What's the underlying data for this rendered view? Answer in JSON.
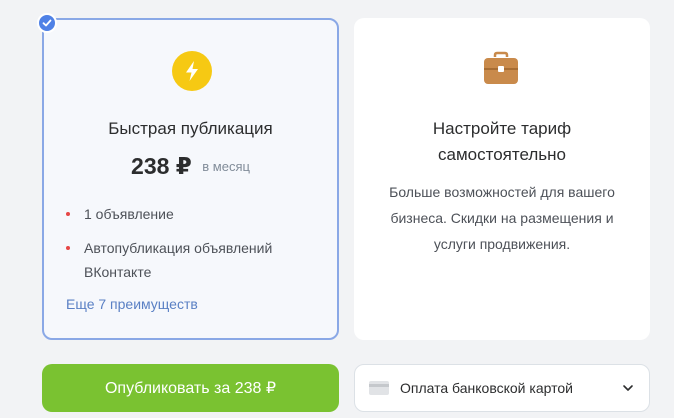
{
  "plans": {
    "selected": {
      "title": "Быстрая публикация",
      "price": "238 ₽",
      "period": "в месяц",
      "features": [
        "1 объявление",
        "Автопубликация объявлений ВКонтакте"
      ],
      "more_link": "Еще 7 преимуществ",
      "icon": "lightning-bolt-icon",
      "check_icon": "checkmark-icon"
    },
    "custom": {
      "title": "Настройте тариф самостоятельно",
      "description": "Больше возможностей для вашего бизнеса. Скидки на размещения и услуги продвижения.",
      "icon": "briefcase-icon"
    }
  },
  "actions": {
    "publish_label": "Опубликовать за 238 ₽",
    "payment_method": "Оплата банковской картой",
    "payment_icon": "bank-card-icon",
    "dropdown_icon": "chevron-down-icon"
  },
  "colors": {
    "accent_blue": "#4f81e6",
    "selected_border": "#8aa8e6",
    "publish_green": "#7ac231",
    "bolt_yellow": "#f6c913",
    "briefcase_brown": "#c98a4b",
    "bullet_red": "#e64646",
    "link_blue": "#5a80c4"
  }
}
